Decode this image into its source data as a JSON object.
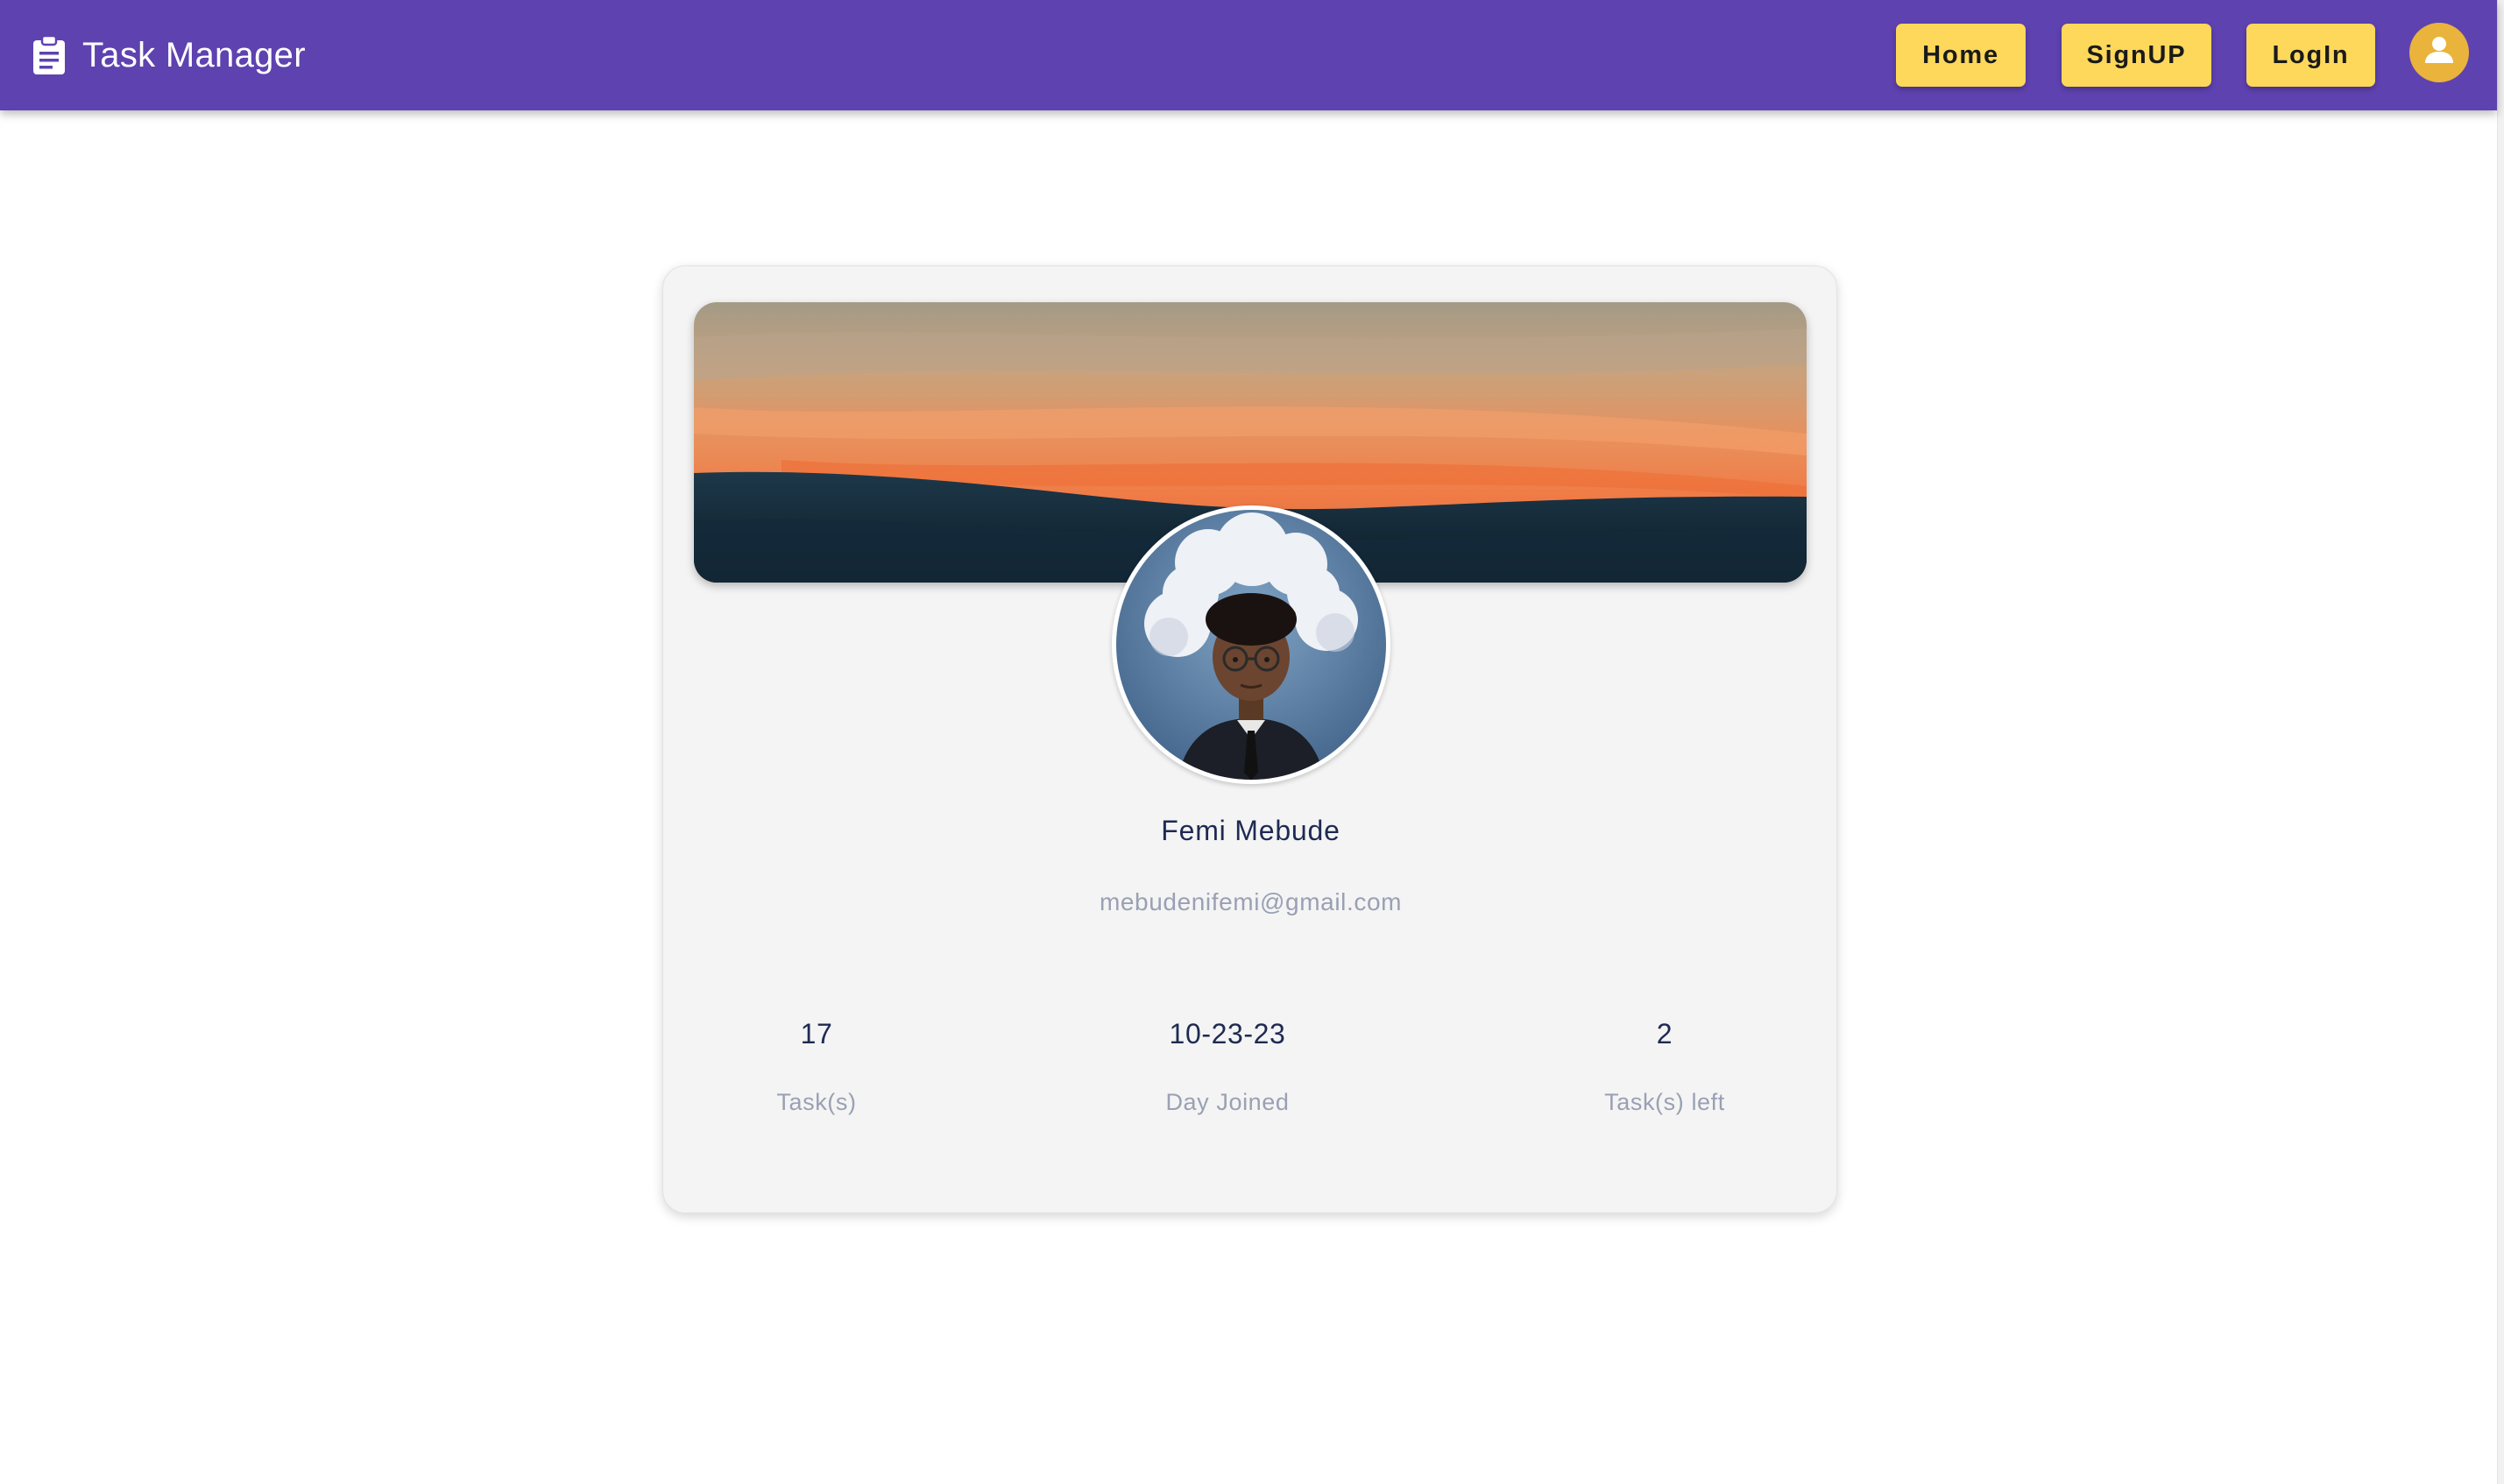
{
  "app": {
    "title": "Task Manager",
    "brand_icon": "clipboard-icon",
    "bar_color": "#5e42b0",
    "button_color": "#fdd85a"
  },
  "nav": {
    "home_label": "Home",
    "signup_label": "SignUP",
    "login_label": "LogIn",
    "account_icon": "account-circle-icon"
  },
  "profile": {
    "name": "Femi Mebude",
    "email": "mebudenifemi@gmail.com",
    "banner_image": "sunset-over-hills",
    "avatar_image": "cartoon-person-with-cloud-head",
    "stats": [
      {
        "value": "17",
        "label": "Task(s)"
      },
      {
        "value": "10-23-23",
        "label": "Day Joined"
      },
      {
        "value": "2",
        "label": "Task(s) left"
      }
    ]
  }
}
